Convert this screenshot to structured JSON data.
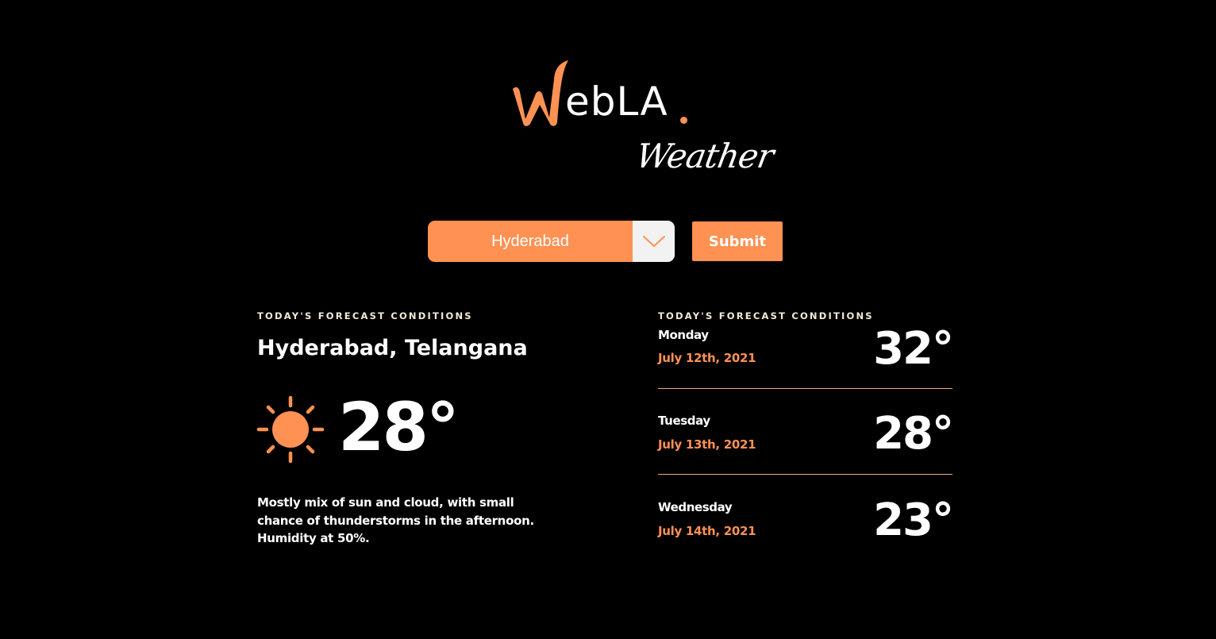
{
  "colors": {
    "accent": "#ff9152",
    "background": "#000000",
    "text": "#ffffff",
    "label": "#f6e9d6",
    "divider": "#f4a779"
  },
  "logo": {
    "first_letter": "W",
    "rest": "ebLA",
    "subtitle": "Weather"
  },
  "controls": {
    "city_selected": "Hyderabad",
    "submit_label": "Submit",
    "arrow_icon": "chevron-down-icon"
  },
  "today": {
    "section_label": "TODAY'S FORECAST CONDITIONS",
    "location": "Hyderabad, Telangana",
    "icon": "sun-icon",
    "temperature": "28°",
    "description": "Mostly mix of sun and cloud, with small chance of thunderstorms in the afternoon. Humidity at 50%."
  },
  "forecast": {
    "section_label": "TODAY'S FORECAST CONDITIONS",
    "days": [
      {
        "day": "Monday",
        "date": "July 12th, 2021",
        "temperature": "32°"
      },
      {
        "day": "Tuesday",
        "date": "July 13th, 2021",
        "temperature": "28°"
      },
      {
        "day": "Wednesday",
        "date": "July 14th, 2021",
        "temperature": "23°"
      }
    ]
  }
}
